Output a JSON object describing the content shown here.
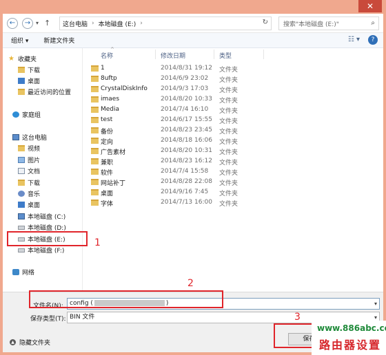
{
  "window": {
    "close_label": "✕"
  },
  "nav": {
    "back": "←",
    "forward": "→",
    "dropdown": "▾",
    "up": "↑",
    "breadcrumb": [
      "这台电脑",
      "本地磁盘 (E:)"
    ],
    "refresh": "↻",
    "search_placeholder": "搜索\"本地磁盘 (E:)\""
  },
  "toolbar": {
    "organize": "组织 ▾",
    "new_folder": "新建文件夹",
    "views": "☷ ▾",
    "help": "?"
  },
  "navpane": {
    "favorites": "收藏夹",
    "downloads": "下载",
    "desktop": "桌面",
    "recent": "最近访问的位置",
    "homegroup": "家庭组",
    "thispc": "这台电脑",
    "videos": "视频",
    "pictures": "图片",
    "documents": "文档",
    "downloads2": "下载",
    "music": "音乐",
    "desktop2": "桌面",
    "drive_c": "本地磁盘 (C:)",
    "drive_d": "本地磁盘 (D:)",
    "drive_e": "本地磁盘 (E:)",
    "drive_f": "本地磁盘 (F:)",
    "network": "网络"
  },
  "columns": {
    "name": "名称",
    "date": "修改日期",
    "type": "类型"
  },
  "files": [
    {
      "name": "1",
      "date": "2014/8/31 19:12",
      "type": "文件夹"
    },
    {
      "name": "8uftp",
      "date": "2014/6/9 23:02",
      "type": "文件夹"
    },
    {
      "name": "CrystalDiskInfo",
      "date": "2014/9/3 17:03",
      "type": "文件夹"
    },
    {
      "name": "imaes",
      "date": "2014/8/20 10:33",
      "type": "文件夹"
    },
    {
      "name": "Media",
      "date": "2014/7/4 16:10",
      "type": "文件夹"
    },
    {
      "name": "test",
      "date": "2014/6/17 15:55",
      "type": "文件夹"
    },
    {
      "name": "备份",
      "date": "2014/8/23 23:45",
      "type": "文件夹"
    },
    {
      "name": "定向",
      "date": "2014/8/18 16:06",
      "type": "文件夹"
    },
    {
      "name": "广告素材",
      "date": "2014/8/20 10:31",
      "type": "文件夹"
    },
    {
      "name": "兼职",
      "date": "2014/8/23 16:12",
      "type": "文件夹"
    },
    {
      "name": "软件",
      "date": "2014/7/4 15:58",
      "type": "文件夹"
    },
    {
      "name": "网站补丁",
      "date": "2014/8/28 22:08",
      "type": "文件夹"
    },
    {
      "name": "桌面",
      "date": "2014/9/16 7:45",
      "type": "文件夹"
    },
    {
      "name": "字体",
      "date": "2014/7/13 16:00",
      "type": "文件夹"
    }
  ],
  "bottom": {
    "filename_label": "文件名(N):",
    "filename_prefix": "config (",
    "filename_suffix": ")",
    "savetype_label": "保存类型(T):",
    "savetype_value": "BIN 文件",
    "hide_folders": "隐藏文件夹",
    "save_button": "保存(S"
  },
  "annotations": {
    "one": "1",
    "two": "2",
    "three": "3"
  },
  "watermark": {
    "url": "www.886abc.com",
    "title": "路由器设置"
  }
}
